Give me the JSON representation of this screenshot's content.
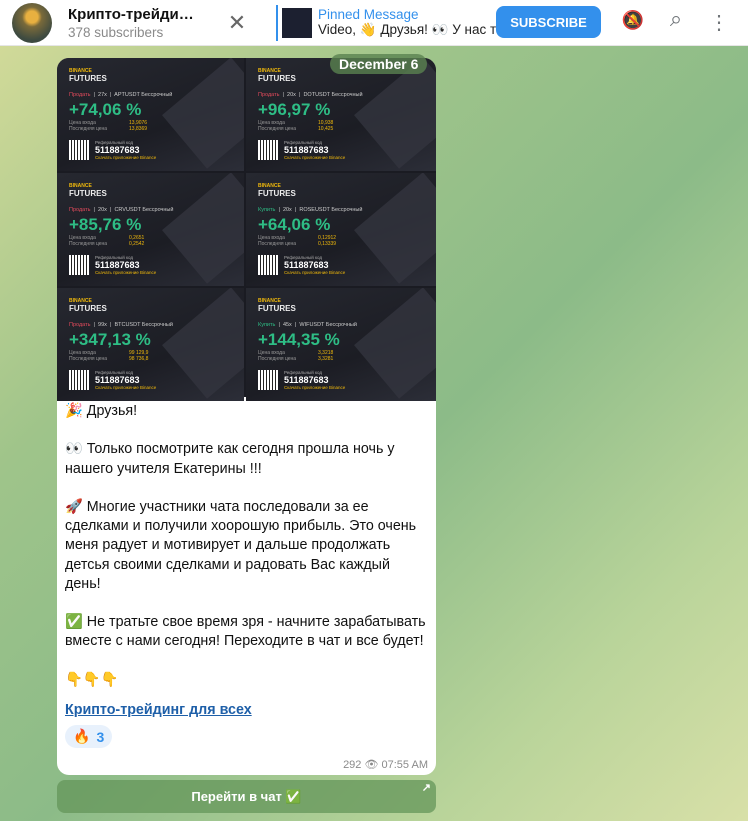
{
  "header": {
    "title": "Крипто-трейди…",
    "subscribers": "378 subscribers",
    "pinned_title": "Pinned Message",
    "pinned_text": "Video, 👋 Друзья! 👀 У нас то…",
    "subscribe": "SUBSCRIBE",
    "close": "✕",
    "mute_icon": "🔕",
    "search_icon": "⌕",
    "menu_icon": "⋮"
  },
  "message": {
    "date": "December 6",
    "cards": [
      {
        "side": "Продать",
        "side_type": "sell",
        "lev": "27x",
        "pair": "APTUSDT Бессрочный",
        "pnl": "+74,06 %",
        "entry": "13,9076",
        "last": "13,8369"
      },
      {
        "side": "Продать",
        "side_type": "sell",
        "lev": "20x",
        "pair": "DOTUSDT Бессрочный",
        "pnl": "+96,97 %",
        "entry": "10,938",
        "last": "10,425"
      },
      {
        "side": "Продать",
        "side_type": "sell",
        "lev": "20x",
        "pair": "CRVUSDT Бессрочный",
        "pnl": "+85,76 %",
        "entry": "0,2651",
        "last": "0,2542"
      },
      {
        "side": "Купить",
        "side_type": "buy",
        "lev": "20x",
        "pair": "ROSEUSDT Бессрочный",
        "pnl": "+64,06 %",
        "entry": "0,12912",
        "last": "0,13339"
      },
      {
        "side": "Продать",
        "side_type": "sell",
        "lev": "99x",
        "pair": "BTCUSDT Бессрочный",
        "pnl": "+347,13 %",
        "entry": "99 129,9",
        "last": "98 736,8"
      },
      {
        "side": "Купить",
        "side_type": "buy",
        "lev": "45x",
        "pair": "WIFUSDT Бессрочный",
        "pnl": "+144,35 %",
        "entry": "3,3218",
        "last": "3,3281"
      }
    ],
    "card_labels": {
      "brand": "BINANCE",
      "futures": "FUTURES",
      "entry": "Цена входа",
      "last": "Последняя цена",
      "ref_label": "Реферальный код",
      "ref_code": "511887683",
      "download": "Скачать приложение Binance"
    },
    "paragraphs": [
      "🎉 Друзья!",
      "👀 Только посмотрите как сегодня прошла ночь у нашего учителя Екатерины !!!",
      "🚀  Многие участники чата последовали за ее сделками и получили хоорошую прибыль. Это очень меня радует и мотивирует и дальше продолжать детсья своими сделками и радовать Вас каждый день!",
      "✅ Не тратьте свое время зря - начните зарабатывать вместе с нами сегодня! Переходите в чат и все будет!",
      "👇👇👇"
    ],
    "link": "Крипто-трейдинг для всех",
    "reaction_emoji": "🔥",
    "reaction_count": "3",
    "views": "292",
    "time": "07:55 AM"
  },
  "chat_button": "Перейти в чат ✅"
}
